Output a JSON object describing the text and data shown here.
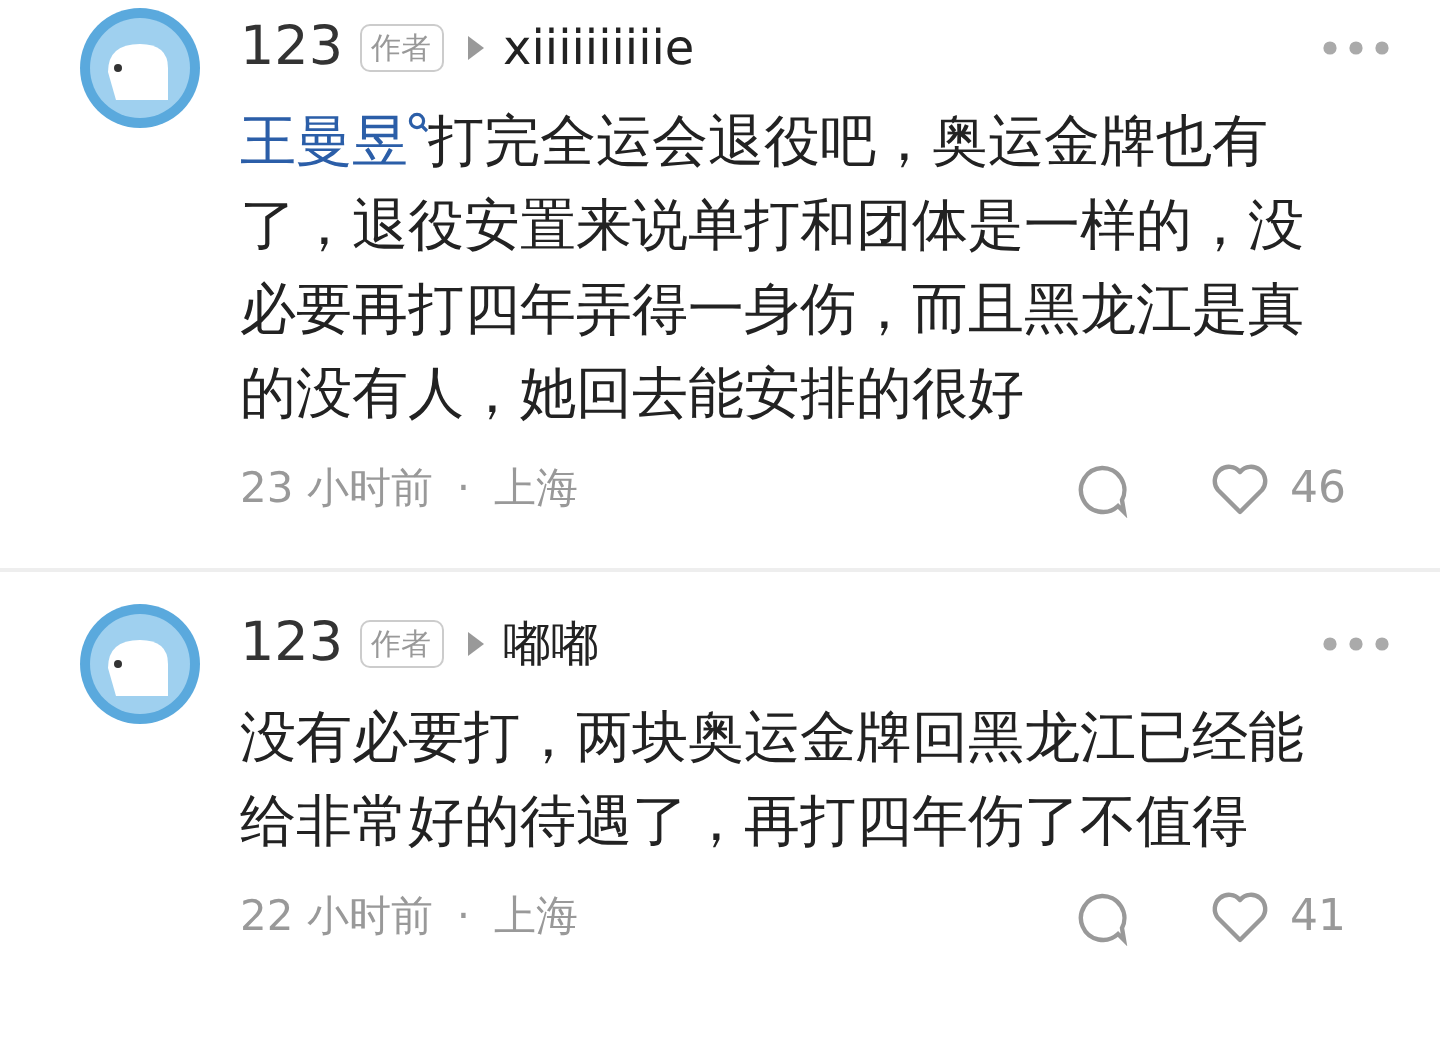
{
  "comments": [
    {
      "author": "123",
      "author_badge": "作者",
      "reply_to": "xiiiiiiiiiie",
      "mention": "王曼昱",
      "text": "打完全运会退役吧，奥运金牌也有了，退役安置来说单打和团体是一样的，没必要再打四年弄得一身伤，而且黑龙江是真的没有人，她回去能安排的很好",
      "time": "23 小时前",
      "separator": "·",
      "location": "上海",
      "likes": "46"
    },
    {
      "author": "123",
      "author_badge": "作者",
      "reply_to": "嘟嘟",
      "text": "没有必要打，两块奥运金牌回黑龙江已经能给非常好的待遇了，再打四年伤了不值得",
      "time": "22 小时前",
      "separator": "·",
      "location": "上海",
      "likes": "41"
    }
  ]
}
